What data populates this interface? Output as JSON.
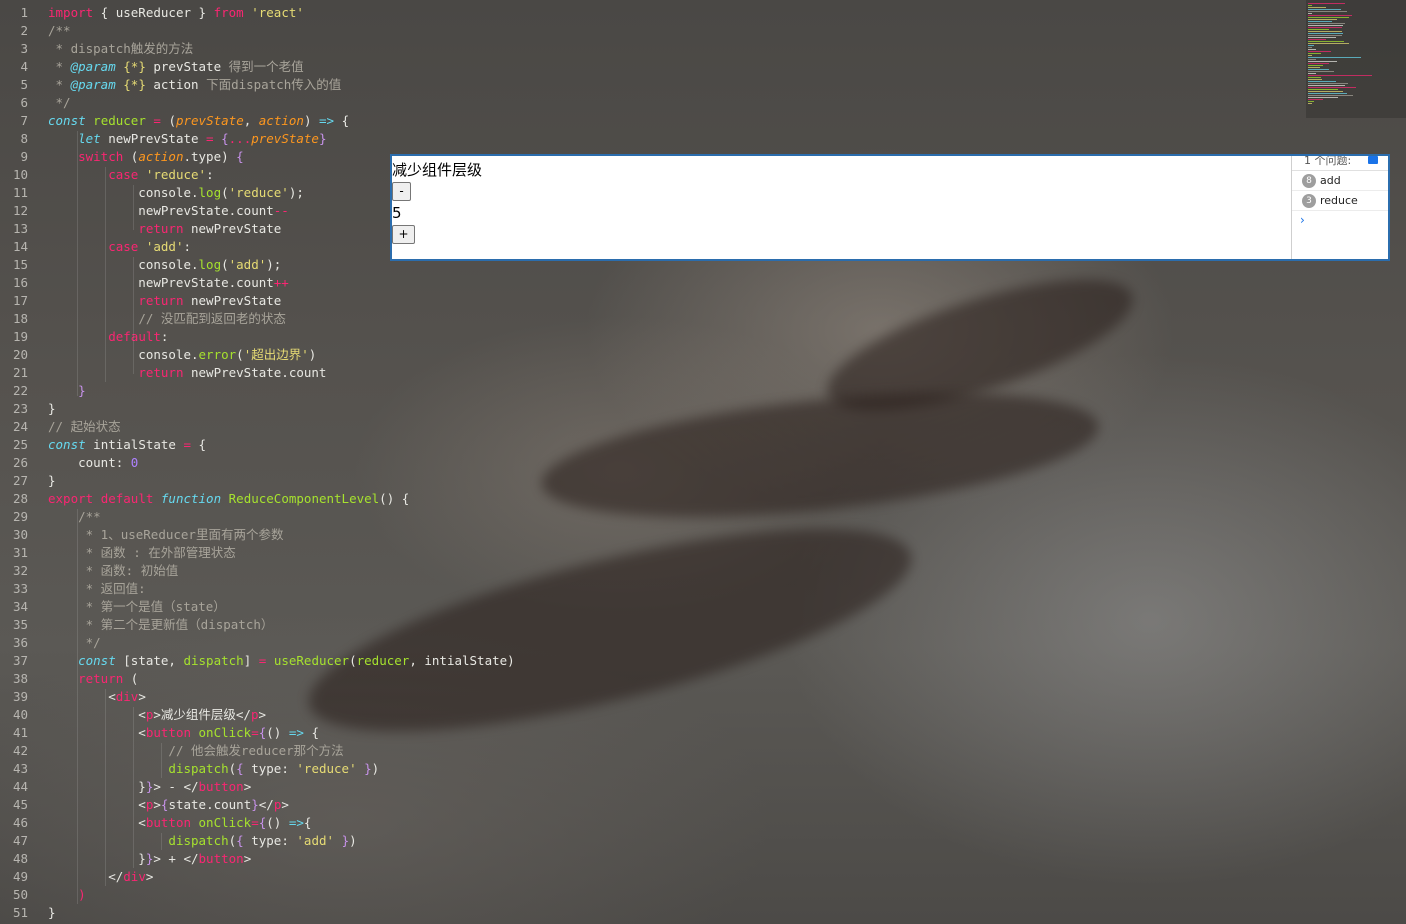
{
  "code": [
    [
      [
        "kw",
        "import"
      ],
      [
        "pl",
        " { useReducer } "
      ],
      [
        "kw",
        "from"
      ],
      [
        "pl",
        " "
      ],
      [
        "str",
        "'react'"
      ]
    ],
    [
      [
        "cm",
        "/**"
      ]
    ],
    [
      [
        "cm",
        " * dispatch触发的方法"
      ]
    ],
    [
      [
        "cm",
        " * "
      ],
      [
        "it",
        "@param"
      ],
      [
        "cm",
        " "
      ],
      [
        "str",
        "{*}"
      ],
      [
        "pl",
        " prevState "
      ],
      [
        "cm",
        "得到一个老值"
      ]
    ],
    [
      [
        "cm",
        " * "
      ],
      [
        "it",
        "@param"
      ],
      [
        "cm",
        " "
      ],
      [
        "str",
        "{*}"
      ],
      [
        "pl",
        " action "
      ],
      [
        "cm",
        "下面dispatch传入的值"
      ]
    ],
    [
      [
        "cm",
        " */"
      ]
    ],
    [
      [
        "it",
        "const"
      ],
      [
        "pl",
        " "
      ],
      [
        "fn",
        "reducer"
      ],
      [
        "pl",
        " "
      ],
      [
        "op",
        "="
      ],
      [
        "pl",
        " ("
      ],
      [
        "par",
        "prevState"
      ],
      [
        "pl",
        ", "
      ],
      [
        "par",
        "action"
      ],
      [
        "pl",
        ") "
      ],
      [
        "it",
        "=>"
      ],
      [
        "pl",
        " {"
      ]
    ],
    [
      [
        "pl",
        "    "
      ],
      [
        "it",
        "let"
      ],
      [
        "pl",
        " newPrevState "
      ],
      [
        "op",
        "="
      ],
      [
        "pl",
        " "
      ],
      [
        "brk",
        "{"
      ],
      [
        "op",
        "..."
      ],
      [
        "par",
        "prevState"
      ],
      [
        "brk",
        "}"
      ]
    ],
    [
      [
        "pl",
        "    "
      ],
      [
        "kw",
        "switch"
      ],
      [
        "pl",
        " ("
      ],
      [
        "par",
        "action"
      ],
      [
        "pl",
        ".type) "
      ],
      [
        "brk",
        "{"
      ]
    ],
    [
      [
        "pl",
        "        "
      ],
      [
        "kw",
        "case"
      ],
      [
        "pl",
        " "
      ],
      [
        "str",
        "'reduce'"
      ],
      [
        "pl",
        ":"
      ]
    ],
    [
      [
        "pl",
        "            console."
      ],
      [
        "fn",
        "log"
      ],
      [
        "pl",
        "("
      ],
      [
        "str",
        "'reduce'"
      ],
      [
        "pl",
        ");"
      ]
    ],
    [
      [
        "pl",
        "            newPrevState.count"
      ],
      [
        "op",
        "--"
      ]
    ],
    [
      [
        "pl",
        "            "
      ],
      [
        "kw",
        "return"
      ],
      [
        "pl",
        " newPrevState"
      ]
    ],
    [
      [
        "pl",
        "        "
      ],
      [
        "kw",
        "case"
      ],
      [
        "pl",
        " "
      ],
      [
        "str",
        "'add'"
      ],
      [
        "pl",
        ":"
      ]
    ],
    [
      [
        "pl",
        "            console."
      ],
      [
        "fn",
        "log"
      ],
      [
        "pl",
        "("
      ],
      [
        "str",
        "'add'"
      ],
      [
        "pl",
        ");"
      ]
    ],
    [
      [
        "pl",
        "            newPrevState.count"
      ],
      [
        "op",
        "++"
      ]
    ],
    [
      [
        "pl",
        "            "
      ],
      [
        "kw",
        "return"
      ],
      [
        "pl",
        " newPrevState"
      ]
    ],
    [
      [
        "pl",
        "            "
      ],
      [
        "cm",
        "// 没匹配到返回老的状态"
      ]
    ],
    [
      [
        "pl",
        "        "
      ],
      [
        "kw",
        "default"
      ],
      [
        "pl",
        ":"
      ]
    ],
    [
      [
        "pl",
        "            console."
      ],
      [
        "fn",
        "error"
      ],
      [
        "pl",
        "("
      ],
      [
        "str",
        "'超出边界'"
      ],
      [
        "pl",
        ")"
      ]
    ],
    [
      [
        "pl",
        "            "
      ],
      [
        "kw",
        "return"
      ],
      [
        "pl",
        " newPrevState.count"
      ]
    ],
    [
      [
        "pl",
        "    "
      ],
      [
        "brk",
        "}"
      ]
    ],
    [
      [
        "pl",
        "}"
      ]
    ],
    [
      [
        "cm",
        "// 起始状态"
      ]
    ],
    [
      [
        "it",
        "const"
      ],
      [
        "pl",
        " intialState "
      ],
      [
        "op",
        "="
      ],
      [
        "pl",
        " {"
      ]
    ],
    [
      [
        "pl",
        "    count: "
      ],
      [
        "num",
        "0"
      ]
    ],
    [
      [
        "pl",
        "}"
      ]
    ],
    [
      [
        "kw",
        "export"
      ],
      [
        "pl",
        " "
      ],
      [
        "kw",
        "default"
      ],
      [
        "pl",
        " "
      ],
      [
        "it",
        "function"
      ],
      [
        "pl",
        " "
      ],
      [
        "fn",
        "ReduceComponentLevel"
      ],
      [
        "pl",
        "() {"
      ]
    ],
    [
      [
        "pl",
        "    "
      ],
      [
        "cm",
        "/**"
      ]
    ],
    [
      [
        "cm",
        "     * 1、useReducer里面有两个参数"
      ]
    ],
    [
      [
        "cm",
        "     * 函数 : 在外部管理状态"
      ]
    ],
    [
      [
        "cm",
        "     * 函数: 初始值"
      ]
    ],
    [
      [
        "cm",
        "     * 返回值:"
      ]
    ],
    [
      [
        "cm",
        "     * 第一个是值（state）"
      ]
    ],
    [
      [
        "cm",
        "     * 第二个是更新值（dispatch）"
      ]
    ],
    [
      [
        "cm",
        "     */"
      ]
    ],
    [
      [
        "pl",
        "    "
      ],
      [
        "it",
        "const"
      ],
      [
        "pl",
        " [state, "
      ],
      [
        "fn",
        "dispatch"
      ],
      [
        "pl",
        "] "
      ],
      [
        "op",
        "="
      ],
      [
        "pl",
        " "
      ],
      [
        "fn",
        "useReducer"
      ],
      [
        "pl",
        "("
      ],
      [
        "fn",
        "reducer"
      ],
      [
        "pl",
        ", intialState)"
      ]
    ],
    [
      [
        "pl",
        "    "
      ],
      [
        "kw",
        "return"
      ],
      [
        "pl",
        " ("
      ]
    ],
    [
      [
        "pl",
        "        <"
      ],
      [
        "tag",
        "div"
      ],
      [
        "pl",
        ">"
      ]
    ],
    [
      [
        "pl",
        "            <"
      ],
      [
        "tag",
        "p"
      ],
      [
        "pl",
        ">减少组件层级</"
      ],
      [
        "tag",
        "p"
      ],
      [
        "pl",
        ">"
      ]
    ],
    [
      [
        "pl",
        "            <"
      ],
      [
        "tag",
        "button"
      ],
      [
        "pl",
        " "
      ],
      [
        "attr",
        "onClick"
      ],
      [
        "op",
        "="
      ],
      [
        "brk",
        "{"
      ],
      [
        "pl",
        "() "
      ],
      [
        "it",
        "=>"
      ],
      [
        "pl",
        " {"
      ]
    ],
    [
      [
        "pl",
        "                "
      ],
      [
        "cm",
        "// 他会触发reducer那个方法"
      ]
    ],
    [
      [
        "pl",
        "                "
      ],
      [
        "fn",
        "dispatch"
      ],
      [
        "pl",
        "("
      ],
      [
        "brk",
        "{"
      ],
      [
        "pl",
        " type: "
      ],
      [
        "str",
        "'reduce'"
      ],
      [
        "pl",
        " "
      ],
      [
        "brk",
        "}"
      ],
      [
        "pl",
        ")"
      ]
    ],
    [
      [
        "pl",
        "            }"
      ],
      [
        "brk",
        "}"
      ],
      [
        "pl",
        "> - </"
      ],
      [
        "tag",
        "button"
      ],
      [
        "pl",
        ">"
      ]
    ],
    [
      [
        "pl",
        "            <"
      ],
      [
        "tag",
        "p"
      ],
      [
        "pl",
        ">"
      ],
      [
        "brk",
        "{"
      ],
      [
        "pl",
        "state.count"
      ],
      [
        "brk",
        "}"
      ],
      [
        "pl",
        "</"
      ],
      [
        "tag",
        "p"
      ],
      [
        "pl",
        ">"
      ]
    ],
    [
      [
        "pl",
        "            <"
      ],
      [
        "tag",
        "button"
      ],
      [
        "pl",
        " "
      ],
      [
        "attr",
        "onClick"
      ],
      [
        "op",
        "="
      ],
      [
        "brk",
        "{"
      ],
      [
        "pl",
        "() "
      ],
      [
        "it",
        "=>"
      ],
      [
        "pl",
        "{"
      ]
    ],
    [
      [
        "pl",
        "                "
      ],
      [
        "fn",
        "dispatch"
      ],
      [
        "pl",
        "("
      ],
      [
        "brk",
        "{"
      ],
      [
        "pl",
        " type: "
      ],
      [
        "str",
        "'add'"
      ],
      [
        "pl",
        " "
      ],
      [
        "brk",
        "}"
      ],
      [
        "pl",
        ")"
      ]
    ],
    [
      [
        "pl",
        "            }"
      ],
      [
        "brk",
        "}"
      ],
      [
        "pl",
        "> + </"
      ],
      [
        "tag",
        "button"
      ],
      [
        "pl",
        ">"
      ]
    ],
    [
      [
        "pl",
        "        </"
      ],
      [
        "tag",
        "div"
      ],
      [
        "pl",
        ">"
      ]
    ],
    [
      [
        "pl",
        "    "
      ],
      [
        "kw",
        ")"
      ]
    ],
    [
      [
        "pl",
        "}"
      ]
    ]
  ],
  "preview": {
    "heading": "减少组件层级",
    "minus_label": "-",
    "count": "5",
    "plus_label": "+"
  },
  "console": {
    "issues_label": "1 个问题:",
    "entries": [
      {
        "count": "8",
        "text": "add"
      },
      {
        "count": "3",
        "text": "reduce"
      }
    ],
    "prompt": "›"
  },
  "colors": {
    "keyword": "#f92672",
    "function": "#a6e22e",
    "string": "#e6db74",
    "italic_keyword": "#66d9ef",
    "parameter": "#fd971f",
    "comment": "#a8a49a",
    "number": "#ae81ff",
    "preview_border": "#2b6dad"
  }
}
